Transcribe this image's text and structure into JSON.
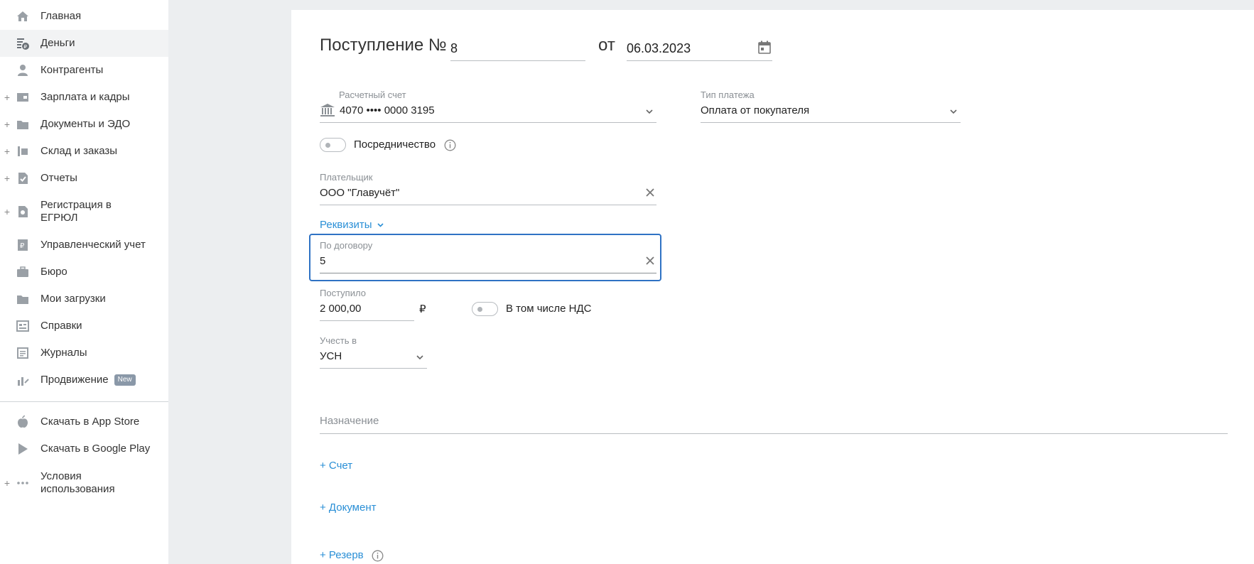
{
  "sidebar": {
    "items": [
      {
        "label": "Главная",
        "icon": "home-icon"
      },
      {
        "label": "Деньги",
        "icon": "money-icon"
      },
      {
        "label": "Контрагенты",
        "icon": "contractor-icon"
      },
      {
        "label": "Зарплата и кадры",
        "icon": "salary-icon"
      },
      {
        "label": "Документы и ЭДО",
        "icon": "folder-icon"
      },
      {
        "label": "Склад и заказы",
        "icon": "warehouse-icon"
      },
      {
        "label": "Отчеты",
        "icon": "report-icon"
      },
      {
        "label": "Регистрация в",
        "label2": "ЕГРЮЛ",
        "icon": "registration-icon"
      },
      {
        "label": "Управленческий учет",
        "icon": "management-icon"
      },
      {
        "label": "Бюро",
        "icon": "briefcase-icon"
      },
      {
        "label": "Мои загрузки",
        "icon": "folder-icon"
      },
      {
        "label": "Справки",
        "icon": "reference-icon"
      },
      {
        "label": "Журналы",
        "icon": "journal-icon"
      },
      {
        "label": "Продвижение",
        "icon": "promotion-icon",
        "badge": "New"
      }
    ],
    "bottom_items": [
      {
        "label": "Скачать в App Store",
        "icon": "apple-icon"
      },
      {
        "label": "Скачать в Google Play",
        "icon": "google-play-icon"
      },
      {
        "label": "Условия",
        "label2": "использования",
        "icon": "more-icon"
      }
    ],
    "expandable_mark": "+"
  },
  "form": {
    "title": "Поступление №",
    "number": "8",
    "date_prefix": "от",
    "date": "06.03.2023",
    "account": {
      "label": "Расчетный счет",
      "value": "4070 •••• 0000 3195"
    },
    "payment_type": {
      "label": "Тип платежа",
      "value": "Оплата от покупателя"
    },
    "intermediary_label": "Посредничество",
    "payer": {
      "label": "Плательщик",
      "value": "ООО \"Главучёт\""
    },
    "requisites_link": "Реквизиты",
    "contract": {
      "label": "По договору",
      "value": "5"
    },
    "received": {
      "label": "Поступило",
      "value": "2 000,00",
      "currency": "₽"
    },
    "vat_label": "В том числе НДС",
    "account_in": {
      "label": "Учесть в",
      "value": "УСН"
    },
    "purpose_placeholder": "Назначение",
    "add_invoice": "+ Счет",
    "add_document": "+ Документ",
    "add_reserve": "+ Резерв"
  },
  "colors": {
    "accent": "#2a8fd6",
    "focus": "#2f72c4",
    "background": "#eceef0"
  }
}
